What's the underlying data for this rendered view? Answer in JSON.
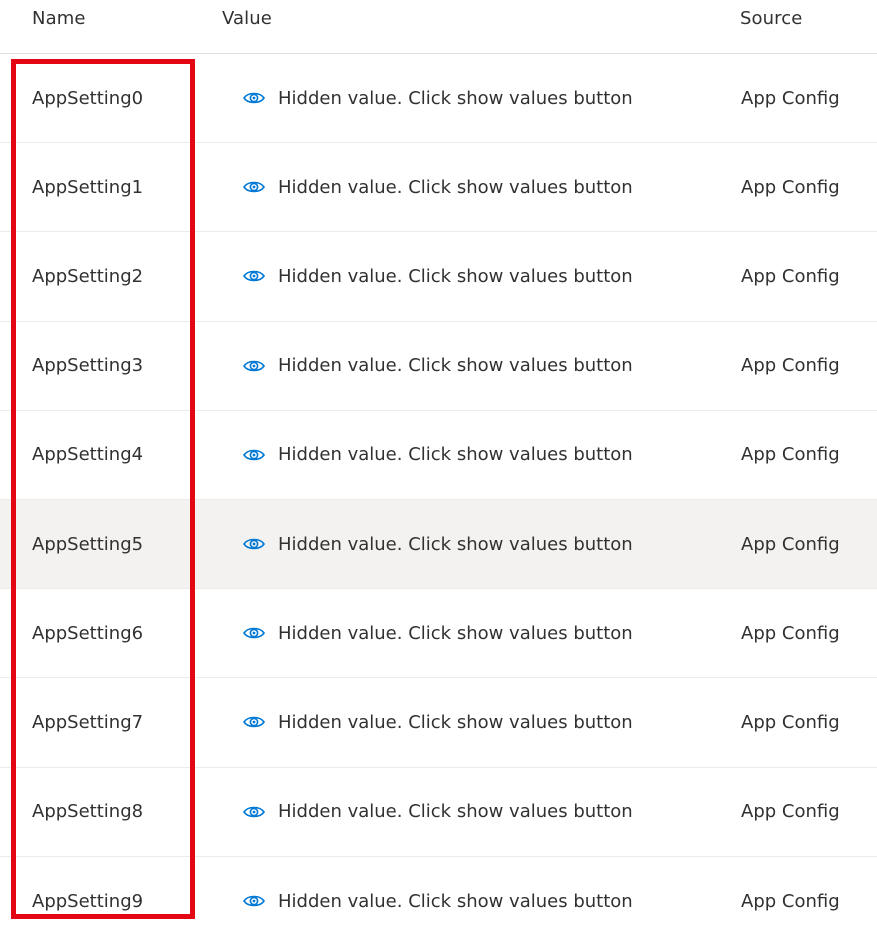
{
  "columns": {
    "name": "Name",
    "value": "Value",
    "source": "Source"
  },
  "rows": [
    {
      "name": "AppSetting0",
      "value": "Hidden value. Click show values button",
      "source": "App Config"
    },
    {
      "name": "AppSetting1",
      "value": "Hidden value. Click show values button",
      "source": "App Config"
    },
    {
      "name": "AppSetting2",
      "value": "Hidden value. Click show values button",
      "source": "App Config"
    },
    {
      "name": "AppSetting3",
      "value": "Hidden value. Click show values button",
      "source": "App Config"
    },
    {
      "name": "AppSetting4",
      "value": "Hidden value. Click show values button",
      "source": "App Config"
    },
    {
      "name": "AppSetting5",
      "value": "Hidden value. Click show values button",
      "source": "App Config"
    },
    {
      "name": "AppSetting6",
      "value": "Hidden value. Click show values button",
      "source": "App Config"
    },
    {
      "name": "AppSetting7",
      "value": "Hidden value. Click show values button",
      "source": "App Config"
    },
    {
      "name": "AppSetting8",
      "value": "Hidden value. Click show values button",
      "source": "App Config"
    },
    {
      "name": "AppSetting9",
      "value": "Hidden value. Click show values button",
      "source": "App Config"
    }
  ],
  "hovered_row": "AppSetting5",
  "icons": {
    "value_icon": "eye-icon"
  },
  "colors": {
    "accent": "#0078d4",
    "highlight": "#e30613",
    "hover_row": "#f3f2f1"
  }
}
